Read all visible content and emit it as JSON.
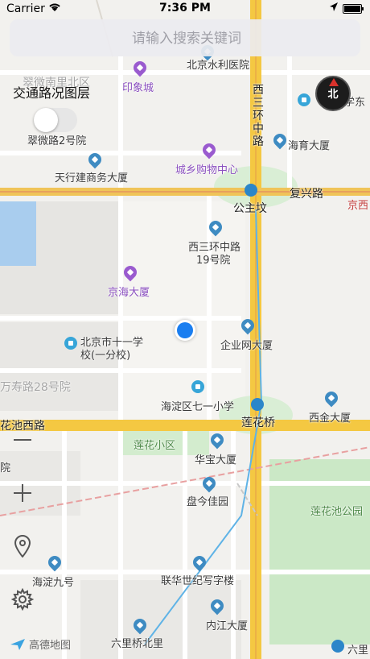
{
  "status_bar": {
    "carrier": "Carrier",
    "time": "7:36 PM"
  },
  "search": {
    "placeholder": "请输入搜索关键词"
  },
  "traffic_layer": {
    "label": "交通路况图层",
    "enabled": false
  },
  "compass": {
    "label": "北"
  },
  "map_labels": {
    "cuiwei_south": "翠微南里北区",
    "yinxiangcheng": "印象城",
    "beijing_water_hospital": "北京水利医院",
    "xisanhuan_zhonglu": "西三环中路",
    "wenxue": "学东",
    "cuiweilu2": "翠微路2号院",
    "haiyu_building": "海育大厦",
    "tianxing_building": "天行建商务大厦",
    "chengxiang_mall": "城乡购物中心",
    "fuxing_road": "复兴路",
    "gongzhufen": "公主坟",
    "east_west": "京西",
    "xisanhuan19": "西三环中路",
    "xisanhuan19_b": "19号院",
    "jinghai_building": "京海大厦",
    "beijing_school_11": "北京市十一学",
    "beijing_school_11_b": "校(一分校)",
    "qiyewang_building": "企业网大厦",
    "wanshou_road": "万寿路28号院",
    "haidian_71": "海淀区七一小学",
    "huachi_west": "花池西路",
    "lianhuaqiao": "莲花桥",
    "xijin_building": "西金大厦",
    "lianhua_area": "莲花小区",
    "huabao_building": "华宝大厦",
    "panjin_garden": "盘今佳园",
    "lianhuachi_park": "莲花池公园",
    "haidian9": "海淀九号",
    "lianhe_century": "联华世纪写字楼",
    "neijiang_building": "内江大厦",
    "liuliqiao_north": "六里桥北里",
    "liuliqiao": "六里",
    "lane": "院"
  },
  "controls": {
    "zoom_out_icon": "minus-icon",
    "zoom_in_icon": "plus-icon",
    "locate_icon": "location-pin-icon",
    "settings_icon": "gear-icon"
  },
  "logo": {
    "text": "高德地图"
  },
  "colors": {
    "main_road": "#f4c842",
    "water": "#a9cdee",
    "green": "#cbe8c6",
    "user_dot": "#1a7ef0"
  }
}
